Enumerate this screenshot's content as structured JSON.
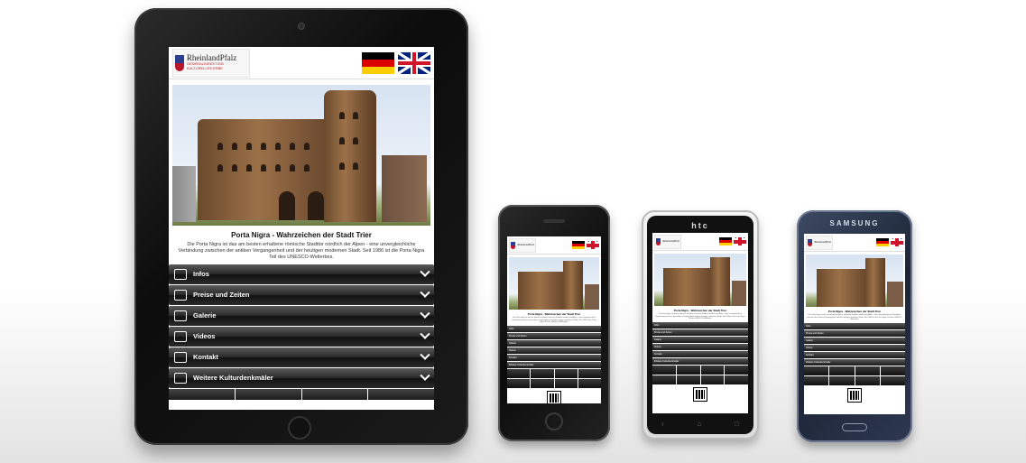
{
  "app": {
    "logo_title": "RheinlandPfalz",
    "logo_subtitle": "GENERALDIREKTION KULTURELLES ERBE",
    "language_flags": [
      "german-flag",
      "uk-flag"
    ],
    "page_title": "Porta Nigra - Wahrzeichen der Stadt Trier",
    "page_text": "Die Porta Nigra ist das am besten erhaltene römische Stadttor nördlich der Alpen - eine unvergleichliche Verbindung zwischen der antiken Vergangenheit und der heutigen modernen Stadt. Seit 1986 ist die Porta Nigra Teil des UNESCO-Welterbes.",
    "menu": [
      {
        "label": "Infos",
        "icon": "edit-icon"
      },
      {
        "label": "Preise und Zeiten",
        "icon": "edit-icon"
      },
      {
        "label": "Galerie",
        "icon": "camera-icon"
      },
      {
        "label": "Videos",
        "icon": "video-icon"
      },
      {
        "label": "Kontakt",
        "icon": "envelope-icon"
      },
      {
        "label": "Weitere Kulturdenkmäler",
        "icon": "list-icon"
      }
    ]
  },
  "devices": {
    "htc_brand": "htc",
    "samsung_brand": "SAMSUNG"
  },
  "colors": {
    "menu_bar": "#1a1a1a",
    "menu_text": "#ffffff",
    "de_black": "#000000",
    "de_red": "#dd0000",
    "de_gold": "#ffce00",
    "uk_blue": "#00247d",
    "uk_red": "#cf142b"
  }
}
